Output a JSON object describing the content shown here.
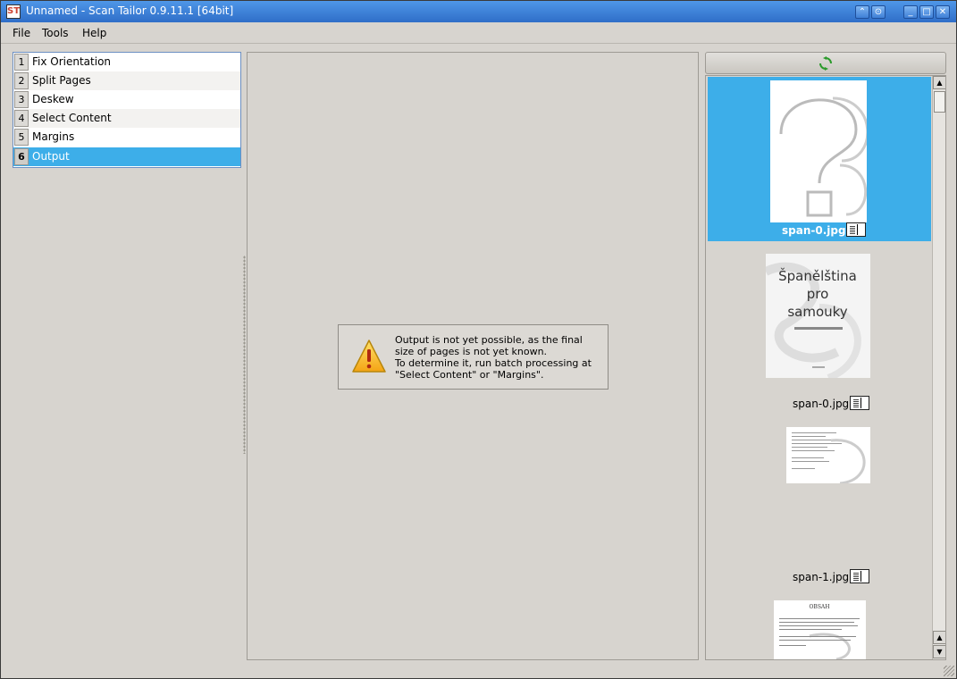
{
  "window": {
    "title": "Unnamed - Scan Tailor 0.9.11.1 [64bit]",
    "app_icon_text": "ST",
    "controls": [
      "restore-icon",
      "settings-icon",
      "minimize-icon",
      "maximize-icon",
      "close-icon"
    ]
  },
  "menu": {
    "file": "File",
    "tools": "Tools",
    "help": "Help"
  },
  "stages": [
    {
      "num": "1",
      "label": "Fix Orientation"
    },
    {
      "num": "2",
      "label": "Split Pages"
    },
    {
      "num": "3",
      "label": "Deskew"
    },
    {
      "num": "4",
      "label": "Select Content"
    },
    {
      "num": "5",
      "label": "Margins"
    },
    {
      "num": "6",
      "label": "Output",
      "selected": true
    }
  ],
  "warning": {
    "lines": [
      "Output is not yet possible, as the final",
      "size of pages is not yet known.",
      "To determine it, run batch processing at",
      "\"Select Content\" or \"Margins\"."
    ]
  },
  "thumbnails": [
    {
      "caption": "span-0.jpg",
      "selected": true
    },
    {
      "caption": "span-0.jpg",
      "title_lines": [
        "Španělština",
        "pro",
        "samouky"
      ]
    },
    {
      "caption": "span-1.jpg"
    },
    {
      "caption": "",
      "heading": "OBSAH"
    }
  ],
  "colors": {
    "selection": "#3daee9",
    "titlebar": "#3a7fd5"
  }
}
